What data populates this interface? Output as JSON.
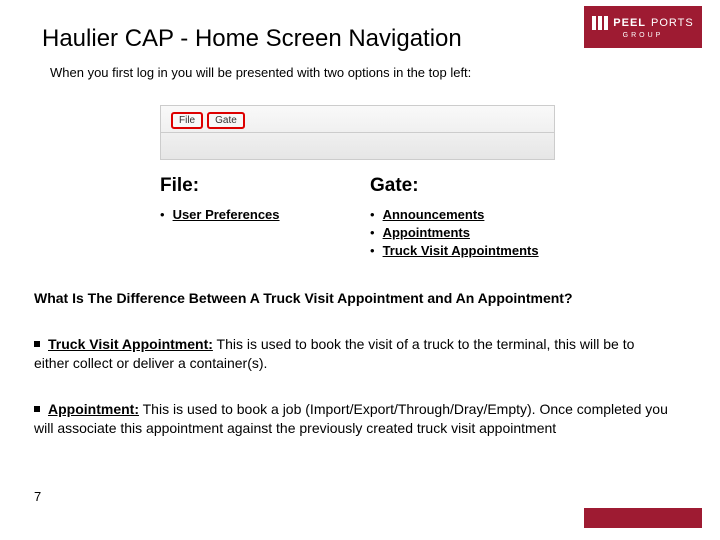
{
  "brand": {
    "name1": "PEEL",
    "name2": "PORTS",
    "sub": "GROUP"
  },
  "title": "Haulier CAP - Home Screen Navigation",
  "intro": "When you first log in you will be presented with two options in the top left:",
  "menu": {
    "file": "File",
    "gate": "Gate"
  },
  "file": {
    "heading": "File:",
    "items": [
      "User Preferences"
    ]
  },
  "gate": {
    "heading": "Gate:",
    "items": [
      "Announcements",
      "Appointments",
      "Truck Visit Appointments"
    ]
  },
  "question": "What Is The Difference Between A Truck Visit Appointment and An Appointment?",
  "para1": {
    "label": "Truck Visit Appointment:",
    "text": " This is used to book the visit of a truck to the terminal, this will be to either collect or deliver a container(s)."
  },
  "para2": {
    "label": "Appointment:",
    "text": " This is used to book a job (Import/Export/Through/Dray/Empty). Once completed you will associate this appointment against the previously created truck visit appointment"
  },
  "pageNumber": "7"
}
